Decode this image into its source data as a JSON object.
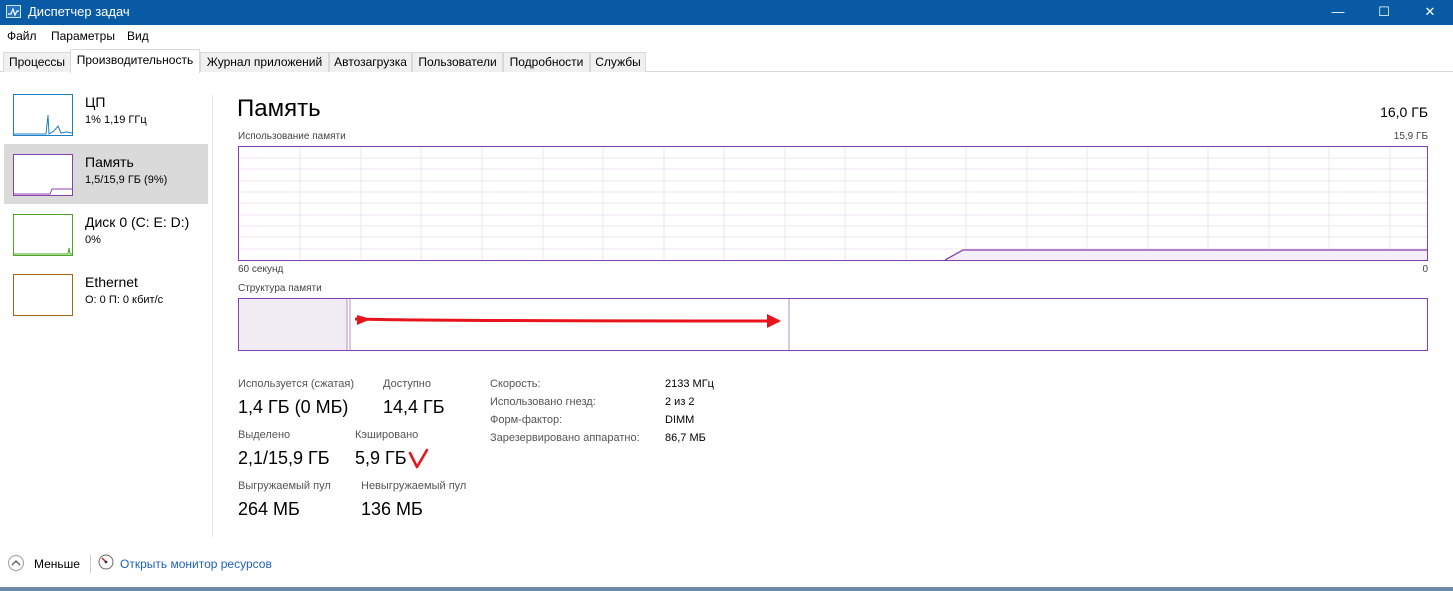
{
  "window": {
    "title": "Диспетчер задач",
    "minimize_glyph": "—",
    "maximize_glyph": "☐",
    "close_glyph": "✕"
  },
  "menu": [
    "Файл",
    "Параметры",
    "Вид"
  ],
  "tabs": [
    "Процессы",
    "Производительность",
    "Журнал приложений",
    "Автозагрузка",
    "Пользователи",
    "Подробности",
    "Службы"
  ],
  "active_tab": "Производительность",
  "sidebar": {
    "items": [
      {
        "title": "ЦП",
        "subtitle": "1% 1,19 ГГц",
        "color": "#1b7fc7"
      },
      {
        "title": "Память",
        "subtitle": "1,5/15,9 ГБ (9%)",
        "color": "#8b3fae"
      },
      {
        "title": "Диск 0 (C: E: D:)",
        "subtitle": "0%",
        "color": "#4da527"
      },
      {
        "title": "Ethernet",
        "subtitle": "О: 0 П: 0 кбит/с",
        "color": "#a7650f"
      }
    ]
  },
  "main": {
    "title": "Память",
    "total": "16,0 ГБ",
    "usage_label": "Использование памяти",
    "usage_max": "15,9 ГБ",
    "time_left": "60 секунд",
    "time_right": "0",
    "composition_label": "Структура памяти",
    "accent_color": "#8b3fae",
    "annotation_color": "#e8141b"
  },
  "stats": {
    "in_use_label": "Используется (сжатая)",
    "in_use_value": "1,4 ГБ (0 МБ)",
    "available_label": "Доступно",
    "available_value": "14,4 ГБ",
    "committed_label": "Выделено",
    "committed_value": "2,1/15,9 ГБ",
    "cached_label": "Кэшировано",
    "cached_value": "5,9 ГБ",
    "paged_label": "Выгружаемый пул",
    "paged_value": "264 МБ",
    "nonpaged_label": "Невыгружаемый пул",
    "nonpaged_value": "136 МБ"
  },
  "properties": [
    {
      "label": "Скорость:",
      "value": "2133 МГц"
    },
    {
      "label": "Использовано гнезд:",
      "value": "2 из 2"
    },
    {
      "label": "Форм-фактор:",
      "value": "DIMM"
    },
    {
      "label": "Зарезервировано аппаратно:",
      "value": "86,7 МБ"
    }
  ],
  "footer": {
    "less_label": "Меньше",
    "monitor_label": "Открыть монитор ресурсов"
  }
}
